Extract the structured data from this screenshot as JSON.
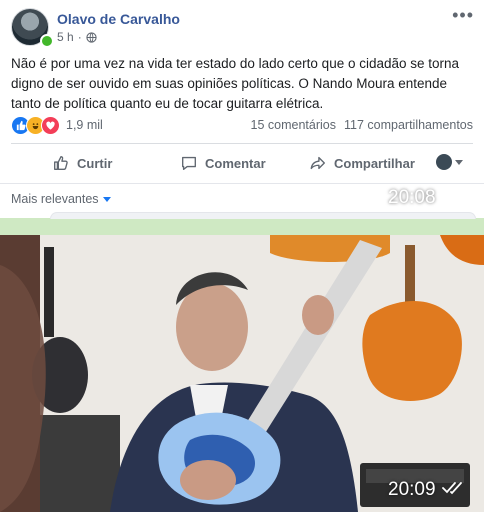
{
  "post": {
    "author": "Olavo de Carvalho",
    "time": "5 h",
    "privacy_icon": "globe-icon",
    "more_icon": "more-options-icon",
    "text": "Não é por uma vez na vida ter estado do lado certo que o cidadão se torna digno de ser ouvido em suas opiniões políticas. O Nando Moura entende tanto de política quanto eu de tocar guitarra elétrica.",
    "reactions": {
      "icons": [
        "like-icon",
        "haha-icon",
        "love-icon"
      ],
      "count": "1,9 mil",
      "comments": "15 comentários",
      "shares": "117 compartilhamentos"
    },
    "actions": {
      "like": "Curtir",
      "comment": "Comentar",
      "share": "Compartilhar"
    },
    "sort_label": "Mais relevantes"
  },
  "messages": [
    {
      "time": "20:08",
      "status_icon": "double-check-icon"
    },
    {
      "time": "20:09",
      "status_icon": "double-check-icon"
    }
  ],
  "colors": {
    "chat_background": "#cfe9c3",
    "facebook_blue": "#385898",
    "online_green": "#42b72a",
    "muted_text": "#606770"
  }
}
